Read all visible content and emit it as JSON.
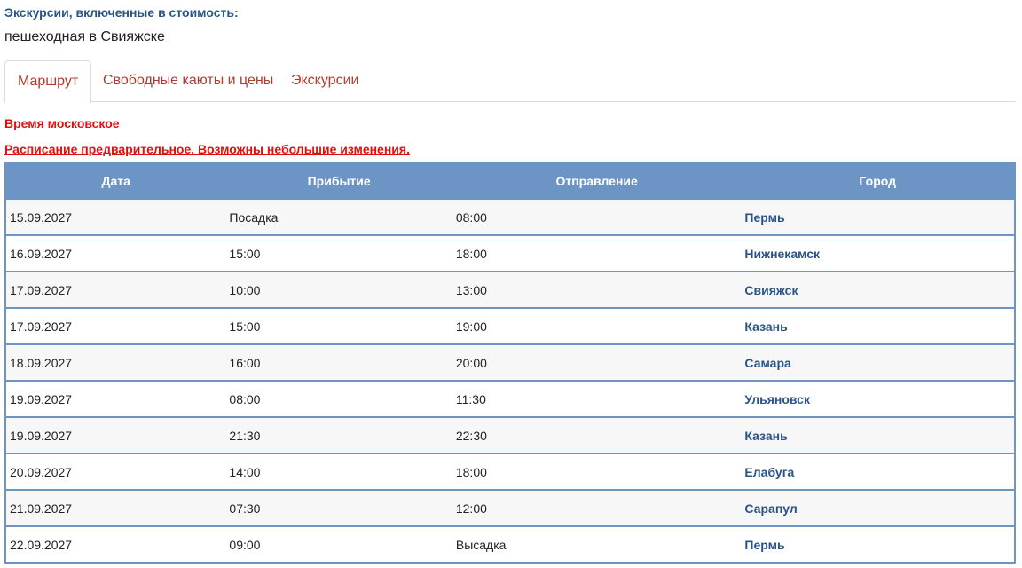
{
  "included": {
    "label": "Экскурсии, включенные в стоимость:",
    "value": "пешеходная в Свияжске"
  },
  "tabs": [
    {
      "label": "Маршрут",
      "active": true
    },
    {
      "label": "Свободные каюты и цены",
      "active": false
    },
    {
      "label": "Экскурсии",
      "active": false
    }
  ],
  "notes": {
    "time_zone": "Время московское",
    "schedule": "Расписание предварительное. Возможны небольшие изменения."
  },
  "table": {
    "headers": {
      "date": "Дата",
      "arrival": "Прибытие",
      "departure": "Отправление",
      "city": "Город"
    },
    "rows": [
      {
        "date": "15.09.2027",
        "arrival": "Посадка",
        "departure": "08:00",
        "city": "Пермь"
      },
      {
        "date": "16.09.2027",
        "arrival": "15:00",
        "departure": "18:00",
        "city": "Нижнекамск"
      },
      {
        "date": "17.09.2027",
        "arrival": "10:00",
        "departure": "13:00",
        "city": "Свияжск"
      },
      {
        "date": "17.09.2027",
        "arrival": "15:00",
        "departure": "19:00",
        "city": "Казань"
      },
      {
        "date": "18.09.2027",
        "arrival": "16:00",
        "departure": "20:00",
        "city": "Самара"
      },
      {
        "date": "19.09.2027",
        "arrival": "08:00",
        "departure": "11:30",
        "city": "Ульяновск"
      },
      {
        "date": "19.09.2027",
        "arrival": "21:30",
        "departure": "22:30",
        "city": "Казань"
      },
      {
        "date": "20.09.2027",
        "arrival": "14:00",
        "departure": "18:00",
        "city": "Елабуга"
      },
      {
        "date": "21.09.2027",
        "arrival": "07:30",
        "departure": "12:00",
        "city": "Сарапул"
      },
      {
        "date": "22.09.2027",
        "arrival": "09:00",
        "departure": "Высадка",
        "city": "Пермь"
      }
    ]
  },
  "colors": {
    "accent_blue": "#2a5488",
    "header_blue": "#6c94c4",
    "tab_red": "#b03a2e",
    "note_red": "#e01010"
  }
}
